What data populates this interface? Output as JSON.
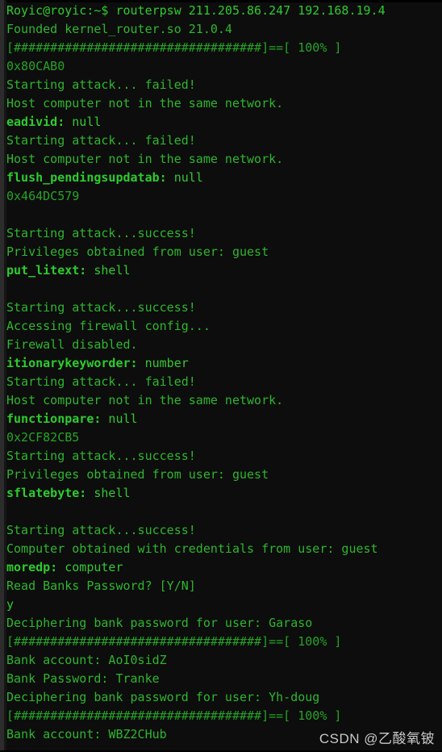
{
  "window": {
    "title": "Terminal",
    "background_color": "#0d0d0d",
    "gutter_color": "#2c2c2c",
    "text_color": "#2fb52f",
    "bold_key_color": "#2ecb2e"
  },
  "watermark": {
    "text": "CSDN @乙酸氧铍",
    "color": "#d8d8d8"
  },
  "progress_bar": {
    "fill_char": "#",
    "fill_count": 34,
    "percent_label": "100%",
    "rendered": "[##################################]==[ 100% ]"
  },
  "terminal": {
    "prompt": "Royic@royic:~$",
    "command": "routerpsw 211.205.86.247 192.168.19.4",
    "lines": [
      {
        "id": "l01",
        "type": "prompt",
        "text": "Royic@royic:~$ routerpsw 211.205.86.247 192.168.19.4"
      },
      {
        "id": "l02",
        "type": "info",
        "text": "Founded kernel_router.so 21.0.4"
      },
      {
        "id": "l03",
        "type": "progress",
        "text": "[##################################]==[ 100% ]"
      },
      {
        "id": "l04",
        "type": "address",
        "text": "0x80CAB0"
      },
      {
        "id": "l05",
        "type": "status-fail",
        "text": "Starting attack... failed!"
      },
      {
        "id": "l06",
        "type": "info",
        "text": "Host computer not in the same network."
      },
      {
        "id": "l07",
        "type": "keyvalue",
        "key": "eadivid:",
        "value": " null"
      },
      {
        "id": "l08",
        "type": "status-fail",
        "text": "Starting attack... failed!"
      },
      {
        "id": "l09",
        "type": "info",
        "text": "Host computer not in the same network."
      },
      {
        "id": "l10",
        "type": "keyvalue",
        "key": "flush_pendingsupdatab:",
        "value": " null"
      },
      {
        "id": "l11",
        "type": "address",
        "text": "0x464DC579"
      },
      {
        "id": "l12",
        "type": "blank",
        "text": ""
      },
      {
        "id": "l13",
        "type": "status-ok",
        "text": "Starting attack...success!"
      },
      {
        "id": "l14",
        "type": "info",
        "text": "Privileges obtained from user: guest"
      },
      {
        "id": "l15",
        "type": "keyvalue",
        "key": "put_litext:",
        "value": " shell"
      },
      {
        "id": "l16",
        "type": "blank",
        "text": ""
      },
      {
        "id": "l17",
        "type": "status-ok",
        "text": "Starting attack...success!"
      },
      {
        "id": "l18",
        "type": "info",
        "text": "Accessing firewall config..."
      },
      {
        "id": "l19",
        "type": "info",
        "text": "Firewall disabled."
      },
      {
        "id": "l20",
        "type": "keyvalue",
        "key": "itionarykeyworder:",
        "value": " number"
      },
      {
        "id": "l21",
        "type": "status-fail",
        "text": "Starting attack... failed!"
      },
      {
        "id": "l22",
        "type": "info",
        "text": "Host computer not in the same network."
      },
      {
        "id": "l23",
        "type": "keyvalue",
        "key": "functionpare:",
        "value": " null"
      },
      {
        "id": "l24",
        "type": "address",
        "text": "0x2CF82CB5"
      },
      {
        "id": "l25",
        "type": "status-ok",
        "text": "Starting attack...success!"
      },
      {
        "id": "l26",
        "type": "info",
        "text": "Privileges obtained from user: guest"
      },
      {
        "id": "l27",
        "type": "keyvalue",
        "key": "sflatebyte:",
        "value": " shell"
      },
      {
        "id": "l28",
        "type": "blank",
        "text": ""
      },
      {
        "id": "l29",
        "type": "status-ok",
        "text": "Starting attack...success!"
      },
      {
        "id": "l30",
        "type": "info",
        "text": "Computer obtained with credentials from user: guest"
      },
      {
        "id": "l31",
        "type": "keyvalue",
        "key": "moredp:",
        "value": " computer"
      },
      {
        "id": "l32",
        "type": "question",
        "text": "Read Banks Password? [Y/N]"
      },
      {
        "id": "l33",
        "type": "user-input",
        "text": "y"
      },
      {
        "id": "l34",
        "type": "info",
        "text": "Deciphering bank password for user: Garaso"
      },
      {
        "id": "l35",
        "type": "progress",
        "text": "[##################################]==[ 100% ]"
      },
      {
        "id": "l36",
        "type": "result",
        "text": "Bank account: AoI0sidZ"
      },
      {
        "id": "l37",
        "type": "result",
        "text": "Bank Password: Tranke"
      },
      {
        "id": "l38",
        "type": "info",
        "text": "Deciphering bank password for user: Yh-doug"
      },
      {
        "id": "l39",
        "type": "progress",
        "text": "[##################################]==[ 100% ]"
      },
      {
        "id": "l40",
        "type": "result",
        "text": "Bank account: WBZ2CHub"
      }
    ],
    "extracted_credentials": [
      {
        "user": "Garaso",
        "account": "AoI0sidZ",
        "password": "Tranke"
      },
      {
        "user": "Yh-doug",
        "account": "WBZ2CHub",
        "password": ""
      }
    ],
    "ip_targets": [
      "211.205.86.247",
      "192.168.19.4"
    ],
    "module": "kernel_router.so",
    "module_version": "21.0.4",
    "addresses": [
      "0x80CAB0",
      "0x464DC579",
      "0x2CF82CB5"
    ]
  }
}
